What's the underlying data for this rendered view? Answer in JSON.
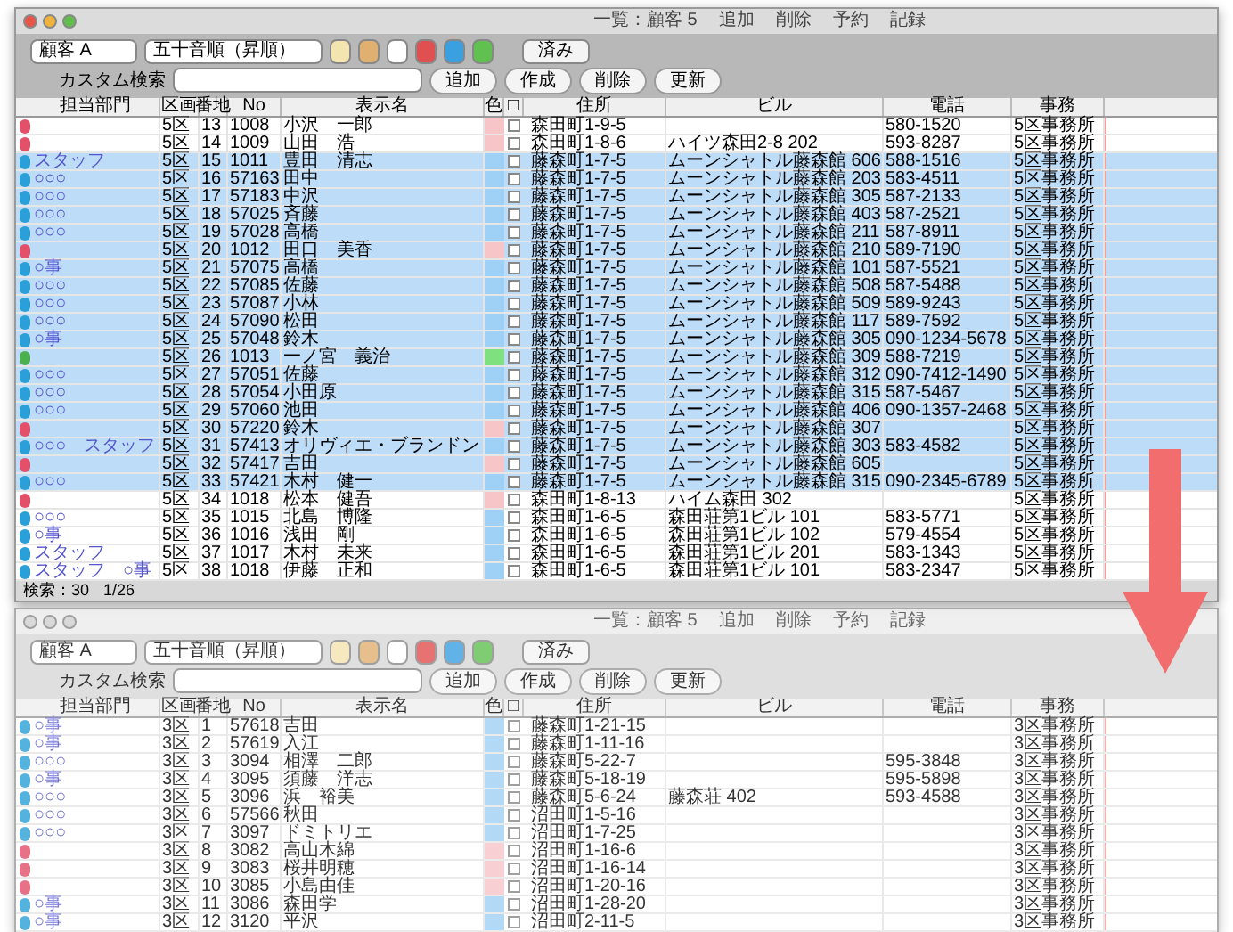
{
  "windows": [
    {
      "title": "一覧：顧客 5",
      "title_items": [
        "追加",
        "削除",
        "予約",
        "記録"
      ],
      "active": true,
      "toolbar": {
        "sort_popup": "顧客 A",
        "order_popup": "五十音順（昇順）",
        "done_button": "済み",
        "search_label": "カスタム検索",
        "buttons": [
          "追加",
          "作成",
          "削除",
          "更新"
        ]
      },
      "columns": [
        "担当部門",
        "区画",
        "番地",
        "No",
        "表示名",
        "色",
        "□",
        "住所",
        "ビル",
        "電話",
        "事務"
      ],
      "rows": [
        {
          "kind": "pink",
          "selected": false,
          "dept": "",
          "area": "5区",
          "num": "13",
          "code": "1008",
          "name": "小沢　一郎",
          "address": "森田町1-9-5",
          "building": "",
          "phone": "580-1520",
          "office": "5区事務所"
        },
        {
          "kind": "pink",
          "selected": false,
          "dept": "",
          "area": "5区",
          "num": "14",
          "code": "1009",
          "name": "山田　浩",
          "address": "森田町1-8-6",
          "building": "ハイツ森田2-8 202",
          "phone": "593-8287",
          "office": "5区事務所"
        },
        {
          "kind": "blue",
          "selected": true,
          "dept": "スタッフ",
          "area": "5区",
          "num": "15",
          "code": "1011",
          "name": "豊田　清志",
          "address": "藤森町1-7-5",
          "building": "ムーンシャトル藤森館 606",
          "phone": "588-1516",
          "office": "5区事務所"
        },
        {
          "kind": "blue",
          "selected": true,
          "dept": "○○○",
          "area": "5区",
          "num": "16",
          "code": "57163",
          "name": "田中",
          "address": "藤森町1-7-5",
          "building": "ムーンシャトル藤森館 203",
          "phone": "583-4511",
          "office": "5区事務所"
        },
        {
          "kind": "blue",
          "selected": true,
          "dept": "○○○",
          "area": "5区",
          "num": "17",
          "code": "57183",
          "name": "中沢",
          "address": "藤森町1-7-5",
          "building": "ムーンシャトル藤森館 305",
          "phone": "587-2133",
          "office": "5区事務所"
        },
        {
          "kind": "blue",
          "selected": true,
          "dept": "○○○",
          "area": "5区",
          "num": "18",
          "code": "57025",
          "name": "斉藤",
          "address": "藤森町1-7-5",
          "building": "ムーンシャトル藤森館 403",
          "phone": "587-2521",
          "office": "5区事務所"
        },
        {
          "kind": "blue",
          "selected": true,
          "dept": "○○○",
          "area": "5区",
          "num": "19",
          "code": "57028",
          "name": "高橋",
          "address": "藤森町1-7-5",
          "building": "ムーンシャトル藤森館 211",
          "phone": "587-8911",
          "office": "5区事務所"
        },
        {
          "kind": "pink",
          "selected": true,
          "dept": "",
          "area": "5区",
          "num": "20",
          "code": "1012",
          "name": "田口　美香",
          "address": "藤森町1-7-5",
          "building": "ムーンシャトル藤森館 210",
          "phone": "589-7190",
          "office": "5区事務所"
        },
        {
          "kind": "blue",
          "selected": true,
          "dept": "○事",
          "area": "5区",
          "num": "21",
          "code": "57075",
          "name": "高橋",
          "address": "藤森町1-7-5",
          "building": "ムーンシャトル藤森館 101",
          "phone": "587-5521",
          "office": "5区事務所"
        },
        {
          "kind": "blue",
          "selected": true,
          "dept": "○○○",
          "area": "5区",
          "num": "22",
          "code": "57085",
          "name": "佐藤",
          "address": "藤森町1-7-5",
          "building": "ムーンシャトル藤森館 508",
          "phone": "587-5488",
          "office": "5区事務所"
        },
        {
          "kind": "blue",
          "selected": true,
          "dept": "○○○",
          "area": "5区",
          "num": "23",
          "code": "57087",
          "name": "小林",
          "address": "藤森町1-7-5",
          "building": "ムーンシャトル藤森館 509",
          "phone": "589-9243",
          "office": "5区事務所"
        },
        {
          "kind": "blue",
          "selected": true,
          "dept": "○○○",
          "area": "5区",
          "num": "24",
          "code": "57090",
          "name": "松田",
          "address": "藤森町1-7-5",
          "building": "ムーンシャトル藤森館 117",
          "phone": "589-7592",
          "office": "5区事務所"
        },
        {
          "kind": "blue",
          "selected": true,
          "dept": "○事",
          "area": "5区",
          "num": "25",
          "code": "57048",
          "name": "鈴木",
          "address": "藤森町1-7-5",
          "building": "ムーンシャトル藤森館 305",
          "phone": "090-1234-5678",
          "office": "5区事務所"
        },
        {
          "kind": "green",
          "selected": true,
          "dept": "",
          "area": "5区",
          "num": "26",
          "code": "1013",
          "name": "一ノ宮　義治",
          "address": "藤森町1-7-5",
          "building": "ムーンシャトル藤森館 309",
          "phone": "588-7219",
          "office": "5区事務所"
        },
        {
          "kind": "blue",
          "selected": true,
          "dept": "○○○",
          "area": "5区",
          "num": "27",
          "code": "57051",
          "name": "佐藤",
          "address": "藤森町1-7-5",
          "building": "ムーンシャトル藤森館 312",
          "phone": "090-7412-1490",
          "office": "5区事務所"
        },
        {
          "kind": "blue",
          "selected": true,
          "dept": "○○○",
          "area": "5区",
          "num": "28",
          "code": "57054",
          "name": "小田原",
          "address": "藤森町1-7-5",
          "building": "ムーンシャトル藤森館 315",
          "phone": "587-5467",
          "office": "5区事務所"
        },
        {
          "kind": "blue",
          "selected": true,
          "dept": "○○○",
          "area": "5区",
          "num": "29",
          "code": "57060",
          "name": "池田",
          "address": "藤森町1-7-5",
          "building": "ムーンシャトル藤森館 406",
          "phone": "090-1357-2468",
          "office": "5区事務所"
        },
        {
          "kind": "pink",
          "selected": true,
          "dept": "",
          "area": "5区",
          "num": "30",
          "code": "57220",
          "name": "鈴木",
          "address": "藤森町1-7-5",
          "building": "ムーンシャトル藤森館 307",
          "phone": "",
          "office": "5区事務所"
        },
        {
          "kind": "blue",
          "selected": true,
          "dept": "○○○　スタッフ",
          "area": "5区",
          "num": "31",
          "code": "57413",
          "name": "オリヴィエ・ブランドン",
          "address": "藤森町1-7-5",
          "building": "ムーンシャトル藤森館 303",
          "phone": "583-4582",
          "office": "5区事務所"
        },
        {
          "kind": "pink",
          "selected": true,
          "dept": "",
          "area": "5区",
          "num": "32",
          "code": "57417",
          "name": "吉田",
          "address": "藤森町1-7-5",
          "building": "ムーンシャトル藤森館 605",
          "phone": "",
          "office": "5区事務所"
        },
        {
          "kind": "blue",
          "selected": true,
          "dept": "○○○",
          "area": "5区",
          "num": "33",
          "code": "57421",
          "name": "木村　健一",
          "address": "藤森町1-7-5",
          "building": "ムーンシャトル藤森館 315",
          "phone": "090-2345-6789",
          "office": "5区事務所"
        },
        {
          "kind": "pink",
          "selected": false,
          "dept": "",
          "area": "5区",
          "num": "34",
          "code": "1018",
          "name": "松本　健吾",
          "address": "森田町1-8-13",
          "building": "ハイム森田 302",
          "phone": "",
          "office": "5区事務所"
        },
        {
          "kind": "blue",
          "selected": false,
          "dept": "○○○",
          "area": "5区",
          "num": "35",
          "code": "1015",
          "name": "北島　博隆",
          "address": "森田町1-6-5",
          "building": "森田荘第1ビル 101",
          "phone": "583-5771",
          "office": "5区事務所"
        },
        {
          "kind": "blue",
          "selected": false,
          "dept": "○事",
          "area": "5区",
          "num": "36",
          "code": "1016",
          "name": "浅田　剛",
          "address": "森田町1-6-5",
          "building": "森田荘第1ビル 102",
          "phone": "579-4554",
          "office": "5区事務所"
        },
        {
          "kind": "blue",
          "selected": false,
          "dept": "スタッフ",
          "area": "5区",
          "num": "37",
          "code": "1017",
          "name": "木村　未来",
          "address": "森田町1-6-5",
          "building": "森田荘第1ビル 201",
          "phone": "583-1343",
          "office": "5区事務所"
        },
        {
          "kind": "blue",
          "selected": false,
          "dept": "スタッフ　○事",
          "area": "5区",
          "num": "38",
          "code": "1018",
          "name": "伊藤　正和",
          "address": "森田町1-6-5",
          "building": "森田荘第1ビル 101",
          "phone": "583-2347",
          "office": "5区事務所"
        }
      ],
      "status": [
        "検索：30",
        "1/26"
      ]
    },
    {
      "title": "一覧：顧客 5",
      "title_items": [
        "追加",
        "削除",
        "予約",
        "記録"
      ],
      "active": false,
      "toolbar": {
        "sort_popup": "顧客 A",
        "order_popup": "五十音順（昇順）",
        "done_button": "済み",
        "search_label": "カスタム検索",
        "buttons": [
          "追加",
          "作成",
          "削除",
          "更新"
        ]
      },
      "columns": [
        "担当部門",
        "区画",
        "番地",
        "No",
        "表示名",
        "色",
        "□",
        "住所",
        "ビル",
        "電話",
        "事務"
      ],
      "rows": [
        {
          "kind": "blue",
          "selected": false,
          "dept": "○事",
          "area": "3区",
          "num": "1",
          "code": "57618",
          "name": "吉田",
          "address": "藤森町1-21-15",
          "building": "",
          "phone": "",
          "office": "3区事務所"
        },
        {
          "kind": "blue",
          "selected": false,
          "dept": "○事",
          "area": "3区",
          "num": "2",
          "code": "57619",
          "name": "入江",
          "address": "藤森町1-11-16",
          "building": "",
          "phone": "",
          "office": "3区事務所"
        },
        {
          "kind": "blue",
          "selected": false,
          "dept": "○○○",
          "area": "3区",
          "num": "3",
          "code": "3094",
          "name": "相澤　二郎",
          "address": "藤森町5-22-7",
          "building": "",
          "phone": "595-3848",
          "office": "3区事務所"
        },
        {
          "kind": "blue",
          "selected": false,
          "dept": "○事",
          "area": "3区",
          "num": "4",
          "code": "3095",
          "name": "須藤　洋志",
          "address": "藤森町5-18-19",
          "building": "",
          "phone": "595-5898",
          "office": "3区事務所"
        },
        {
          "kind": "blue",
          "selected": false,
          "dept": "○○○",
          "area": "3区",
          "num": "5",
          "code": "3096",
          "name": "浜　裕美",
          "address": "藤森町5-6-24",
          "building": "藤森荘 402",
          "phone": "593-4588",
          "office": "3区事務所"
        },
        {
          "kind": "blue",
          "selected": false,
          "dept": "○○○",
          "area": "3区",
          "num": "6",
          "code": "57566",
          "name": "秋田",
          "address": "沼田町1-5-16",
          "building": "",
          "phone": "",
          "office": "3区事務所"
        },
        {
          "kind": "blue",
          "selected": false,
          "dept": "○○○",
          "area": "3区",
          "num": "7",
          "code": "3097",
          "name": "ドミトリエ",
          "address": "沼田町1-7-25",
          "building": "",
          "phone": "",
          "office": "3区事務所"
        },
        {
          "kind": "pink",
          "selected": false,
          "dept": "",
          "area": "3区",
          "num": "8",
          "code": "3082",
          "name": "高山木綿",
          "address": "沼田町1-16-6",
          "building": "",
          "phone": "",
          "office": "3区事務所"
        },
        {
          "kind": "pink",
          "selected": false,
          "dept": "",
          "area": "3区",
          "num": "9",
          "code": "3083",
          "name": "桜井明穂",
          "address": "沼田町1-16-14",
          "building": "",
          "phone": "",
          "office": "3区事務所"
        },
        {
          "kind": "pink",
          "selected": false,
          "dept": "",
          "area": "3区",
          "num": "10",
          "code": "3085",
          "name": "小島由佳",
          "address": "沼田町1-20-16",
          "building": "",
          "phone": "",
          "office": "3区事務所"
        },
        {
          "kind": "blue",
          "selected": false,
          "dept": "○事",
          "area": "3区",
          "num": "11",
          "code": "3086",
          "name": "森田学",
          "address": "沼田町1-28-20",
          "building": "",
          "phone": "",
          "office": "3区事務所"
        },
        {
          "kind": "blue",
          "selected": false,
          "dept": "○事",
          "area": "3区",
          "num": "12",
          "code": "3120",
          "name": "平沢",
          "address": "沼田町2-11-5",
          "building": "",
          "phone": "",
          "office": "3区事務所"
        }
      ]
    }
  ]
}
